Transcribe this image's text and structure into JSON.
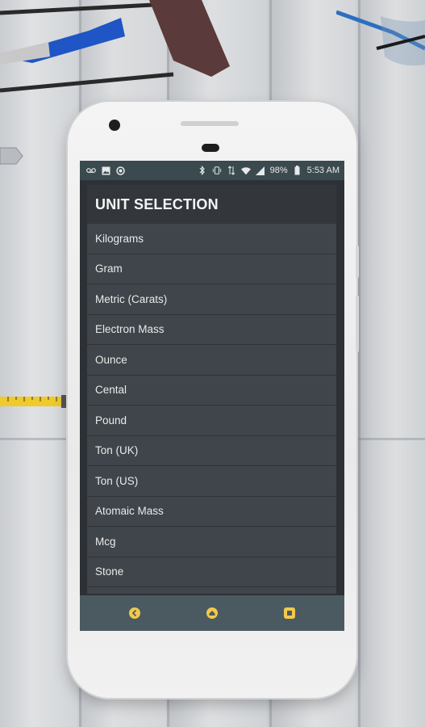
{
  "status_bar": {
    "battery_percent": "98%",
    "time": "5:53 AM",
    "left_icons": [
      "voicemail-icon",
      "image-icon",
      "circle-icon"
    ],
    "right_icons": [
      "bluetooth-icon",
      "vibrate-icon",
      "data-arrows-icon",
      "wifi-icon",
      "signal-icon",
      "battery-icon"
    ]
  },
  "dialog": {
    "title": "UNIT SELECTION",
    "items": [
      {
        "label": "Kilograms"
      },
      {
        "label": "Gram"
      },
      {
        "label": "Metric (Carats)"
      },
      {
        "label": "Electron Mass"
      },
      {
        "label": "Ounce"
      },
      {
        "label": "Cental"
      },
      {
        "label": "Pound"
      },
      {
        "label": "Ton (UK)"
      },
      {
        "label": "Ton (US)"
      },
      {
        "label": "Atomaic Mass"
      },
      {
        "label": "Mcg"
      },
      {
        "label": "Stone"
      }
    ]
  },
  "nav_bar": {
    "buttons": [
      "back-icon",
      "home-icon",
      "recents-icon"
    ],
    "accent": "#f2c94c"
  }
}
